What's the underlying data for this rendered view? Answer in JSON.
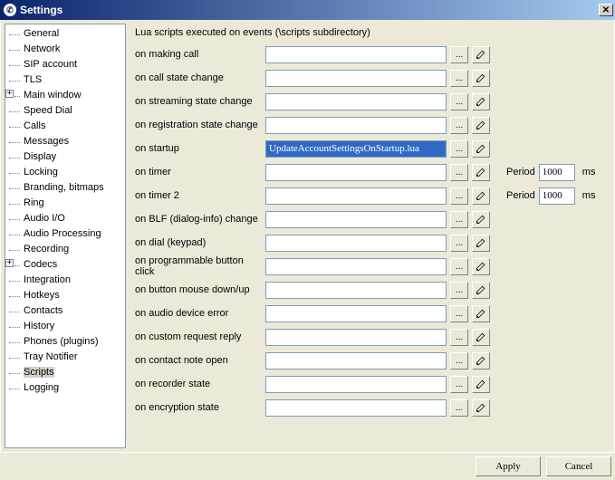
{
  "window": {
    "title": "Settings"
  },
  "tree": {
    "items": [
      {
        "label": "General",
        "expander": null
      },
      {
        "label": "Network",
        "expander": null
      },
      {
        "label": "SIP account",
        "expander": null
      },
      {
        "label": "TLS",
        "expander": null
      },
      {
        "label": "Main window",
        "expander": "+"
      },
      {
        "label": "Speed Dial",
        "expander": null
      },
      {
        "label": "Calls",
        "expander": null
      },
      {
        "label": "Messages",
        "expander": null
      },
      {
        "label": "Display",
        "expander": null
      },
      {
        "label": "Locking",
        "expander": null
      },
      {
        "label": "Branding, bitmaps",
        "expander": null
      },
      {
        "label": "Ring",
        "expander": null
      },
      {
        "label": "Audio I/O",
        "expander": null
      },
      {
        "label": "Audio Processing",
        "expander": null
      },
      {
        "label": "Recording",
        "expander": null
      },
      {
        "label": "Codecs",
        "expander": "+"
      },
      {
        "label": "Integration",
        "expander": null
      },
      {
        "label": "Hotkeys",
        "expander": null
      },
      {
        "label": "Contacts",
        "expander": null
      },
      {
        "label": "History",
        "expander": null
      },
      {
        "label": "Phones (plugins)",
        "expander": null
      },
      {
        "label": "Tray Notifier",
        "expander": null
      },
      {
        "label": "Scripts",
        "expander": null,
        "selected": true
      },
      {
        "label": "Logging",
        "expander": null
      }
    ]
  },
  "panel": {
    "header": "Lua scripts executed on events (\\scripts subdirectory)",
    "period_label": "Period",
    "unit": "ms",
    "browse": "...",
    "rows": [
      {
        "label": "on making call",
        "value": ""
      },
      {
        "label": "on call state change",
        "value": ""
      },
      {
        "label": "on streaming state change",
        "value": ""
      },
      {
        "label": "on registration state change",
        "value": ""
      },
      {
        "label": "on startup",
        "value": "UpdateAccountSettingsOnStartup.lua",
        "highlighted": true
      },
      {
        "label": "on timer",
        "value": "",
        "period": "1000"
      },
      {
        "label": "on timer 2",
        "value": "",
        "period": "1000"
      },
      {
        "label": "on BLF (dialog-info) change",
        "value": ""
      },
      {
        "label": "on dial (keypad)",
        "value": ""
      },
      {
        "label": "on programmable button click",
        "value": ""
      },
      {
        "label": "on button mouse down/up",
        "value": ""
      },
      {
        "label": "on audio device error",
        "value": ""
      },
      {
        "label": "on custom request reply",
        "value": ""
      },
      {
        "label": "on contact note open",
        "value": ""
      },
      {
        "label": "on recorder state",
        "value": ""
      },
      {
        "label": "on encryption state",
        "value": ""
      }
    ]
  },
  "footer": {
    "apply": "Apply",
    "cancel": "Cancel"
  }
}
